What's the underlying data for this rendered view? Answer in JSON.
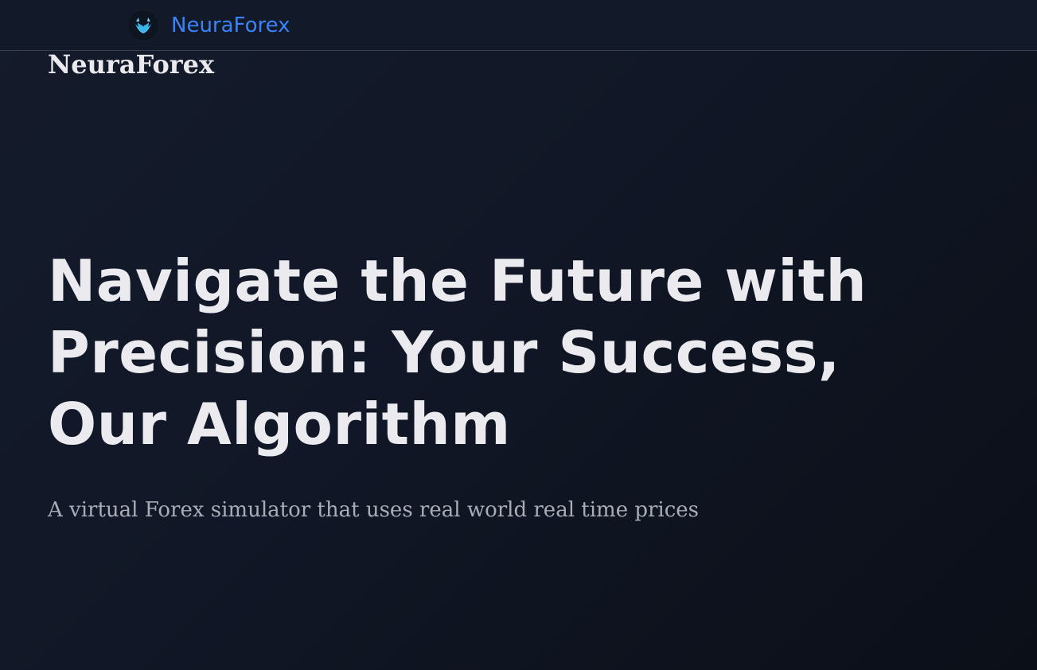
{
  "navbar": {
    "logo_icon": "bull-head-icon",
    "brand_name": "NeuraForex"
  },
  "header": {
    "site_title": "NeuraForex"
  },
  "hero": {
    "title": "Navigate the Future with Precision: Your Success, Our Algorithm",
    "subtitle": "A virtual Forex simulator that uses real world real time prices"
  },
  "colors": {
    "brand_accent": "#3b82f6",
    "background": "#111726",
    "heading_text": "#ebebef",
    "subtitle_text": "#a9adb6"
  }
}
